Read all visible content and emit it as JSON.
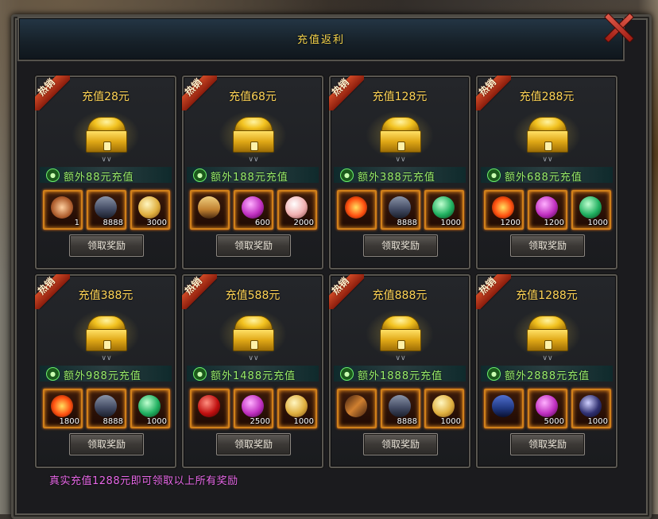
{
  "window": {
    "title": "充值返利",
    "close_icon": "close-x-icon"
  },
  "badge_label": "热销",
  "claim_label": "领取奖励",
  "footer_note": "真实充值1288元即可领取以上所有奖励",
  "colors": {
    "gold": "#ffd455",
    "bonus_green": "#9bf06a",
    "footer_pink": "#e868e8",
    "ribbon_red": "#c23c1c"
  },
  "cards": [
    {
      "title": "充值28元",
      "bonus": "额外88元充值",
      "items": [
        {
          "icon": "crown-item-icon",
          "qty": "1"
        },
        {
          "icon": "anvil-item-icon",
          "qty": "8888"
        },
        {
          "icon": "gold-orb-icon",
          "qty": "3000"
        }
      ]
    },
    {
      "title": "充值68元",
      "bonus": "额外188元充值",
      "items": [
        {
          "icon": "skeleton-figure-icon",
          "qty": ""
        },
        {
          "icon": "purple-orb-icon",
          "qty": "600"
        },
        {
          "icon": "pink-orb-icon",
          "qty": "2000"
        }
      ]
    },
    {
      "title": "充值128元",
      "bonus": "额外388元充值",
      "items": [
        {
          "icon": "fire-item-icon",
          "qty": ""
        },
        {
          "icon": "anvil-item-icon",
          "qty": "8888"
        },
        {
          "icon": "green-orb-icon",
          "qty": "1000"
        }
      ]
    },
    {
      "title": "充值288元",
      "bonus": "额外688元充值",
      "items": [
        {
          "icon": "fire-item-icon",
          "qty": "1200"
        },
        {
          "icon": "purple-orb-icon",
          "qty": "1200"
        },
        {
          "icon": "green-orb-icon",
          "qty": "1000"
        }
      ]
    },
    {
      "title": "充值388元",
      "bonus": "额外988元充值",
      "items": [
        {
          "icon": "fire-item-icon",
          "qty": "1800"
        },
        {
          "icon": "anvil-item-icon",
          "qty": "8888"
        },
        {
          "icon": "green-orb-icon",
          "qty": "1000"
        }
      ]
    },
    {
      "title": "充值588元",
      "bonus": "额外1488元充值",
      "items": [
        {
          "icon": "red-lantern-icon",
          "qty": ""
        },
        {
          "icon": "purple-orb-icon",
          "qty": "2500"
        },
        {
          "icon": "gold-orb-icon",
          "qty": "1000"
        }
      ]
    },
    {
      "title": "充值888元",
      "bonus": "额外1888元充值",
      "items": [
        {
          "icon": "staff-weapon-icon",
          "qty": ""
        },
        {
          "icon": "anvil-item-icon",
          "qty": "8888"
        },
        {
          "icon": "gold-orb-icon",
          "qty": "1000"
        }
      ]
    },
    {
      "title": "充值1288元",
      "bonus": "额外2888元充值",
      "items": [
        {
          "icon": "blue-book-icon",
          "qty": ""
        },
        {
          "icon": "purple-orb-icon",
          "qty": "5000"
        },
        {
          "icon": "dark-orb-icon",
          "qty": "1000"
        }
      ]
    }
  ]
}
